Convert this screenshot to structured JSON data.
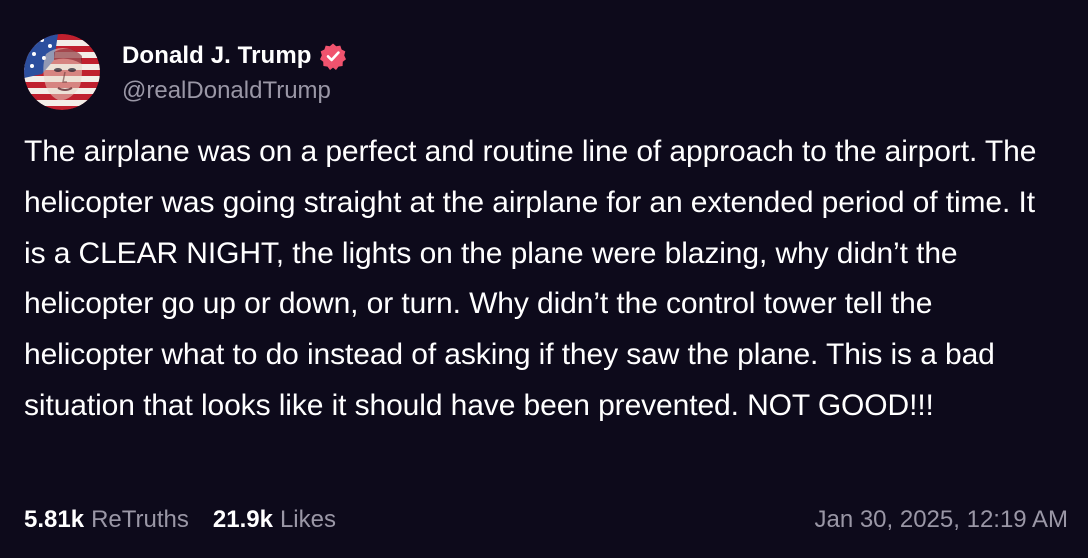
{
  "author": {
    "display_name": "Donald J. Trump",
    "handle": "@realDonaldTrump",
    "verified": true,
    "verified_badge_color": "#f0536e"
  },
  "post": {
    "text": "The airplane was on a perfect and routine line of approach to the airport. The helicopter was going straight at the airplane for an extended period of time. It is a CLEAR NIGHT, the lights on the plane were blazing, why didn’t the helicopter go up or down, or turn. Why didn’t the control tower tell the helicopter what to do instead of asking if they saw the plane. This is a bad situation that looks like it should have been prevented. NOT GOOD!!!",
    "timestamp": "Jan 30, 2025, 12:19 AM"
  },
  "stats": {
    "retruths_count": "5.81k",
    "retruths_label": "ReTruths",
    "likes_count": "21.9k",
    "likes_label": "Likes"
  },
  "colors": {
    "background": "#0d0a1b",
    "primary_text": "#ffffff",
    "secondary_text": "#9a97a6"
  },
  "icons": {
    "avatar": "flag-portrait-avatar",
    "verified": "verified-badge-icon"
  }
}
